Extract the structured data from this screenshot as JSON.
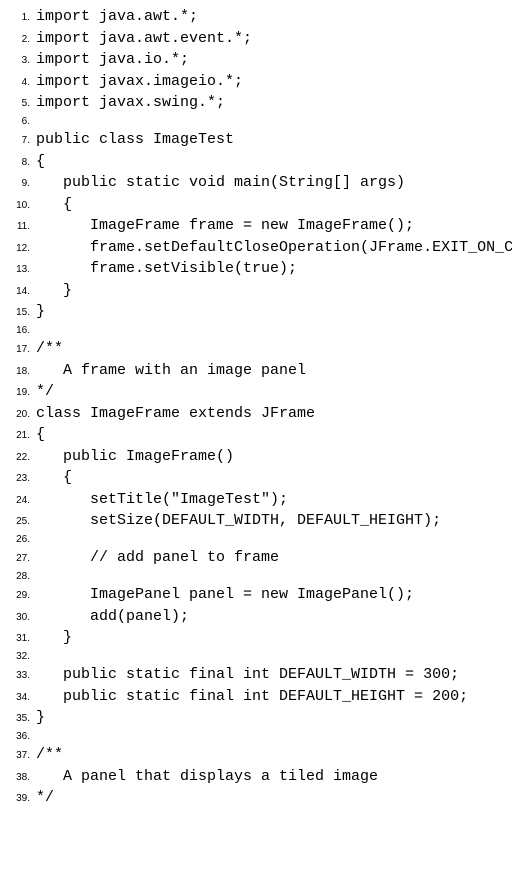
{
  "lines": [
    {
      "n": "1.",
      "c": "import java.awt.*;"
    },
    {
      "n": "2.",
      "c": "import java.awt.event.*;"
    },
    {
      "n": "3.",
      "c": "import java.io.*;"
    },
    {
      "n": "4.",
      "c": "import javax.imageio.*;"
    },
    {
      "n": "5.",
      "c": "import javax.swing.*;"
    },
    {
      "n": "6.",
      "c": ""
    },
    {
      "n": "7.",
      "c": "public class ImageTest"
    },
    {
      "n": "8.",
      "c": "{"
    },
    {
      "n": "9.",
      "c": "   public static void main(String[] args)"
    },
    {
      "n": "10.",
      "c": "   {"
    },
    {
      "n": "11.",
      "c": "      ImageFrame frame = new ImageFrame();"
    },
    {
      "n": "12.",
      "c": "      frame.setDefaultCloseOperation(JFrame.EXIT_ON_CLOSE);"
    },
    {
      "n": "13.",
      "c": "      frame.setVisible(true);"
    },
    {
      "n": "14.",
      "c": "   }"
    },
    {
      "n": "15.",
      "c": "}"
    },
    {
      "n": "16.",
      "c": ""
    },
    {
      "n": "17.",
      "c": "/**"
    },
    {
      "n": "18.",
      "c": "   A frame with an image panel"
    },
    {
      "n": "19.",
      "c": "*/"
    },
    {
      "n": "20.",
      "c": "class ImageFrame extends JFrame"
    },
    {
      "n": "21.",
      "c": "{"
    },
    {
      "n": "22.",
      "c": "   public ImageFrame()"
    },
    {
      "n": "23.",
      "c": "   {"
    },
    {
      "n": "24.",
      "c": "      setTitle(\"ImageTest\");"
    },
    {
      "n": "25.",
      "c": "      setSize(DEFAULT_WIDTH, DEFAULT_HEIGHT);"
    },
    {
      "n": "26.",
      "c": ""
    },
    {
      "n": "27.",
      "c": "      // add panel to frame"
    },
    {
      "n": "28.",
      "c": ""
    },
    {
      "n": "29.",
      "c": "      ImagePanel panel = new ImagePanel();"
    },
    {
      "n": "30.",
      "c": "      add(panel);"
    },
    {
      "n": "31.",
      "c": "   }"
    },
    {
      "n": "32.",
      "c": ""
    },
    {
      "n": "33.",
      "c": "   public static final int DEFAULT_WIDTH = 300;"
    },
    {
      "n": "34.",
      "c": "   public static final int DEFAULT_HEIGHT = 200;"
    },
    {
      "n": "35.",
      "c": "}"
    },
    {
      "n": "36.",
      "c": ""
    },
    {
      "n": "37.",
      "c": "/**"
    },
    {
      "n": "38.",
      "c": "   A panel that displays a tiled image"
    },
    {
      "n": "39.",
      "c": "*/"
    }
  ]
}
